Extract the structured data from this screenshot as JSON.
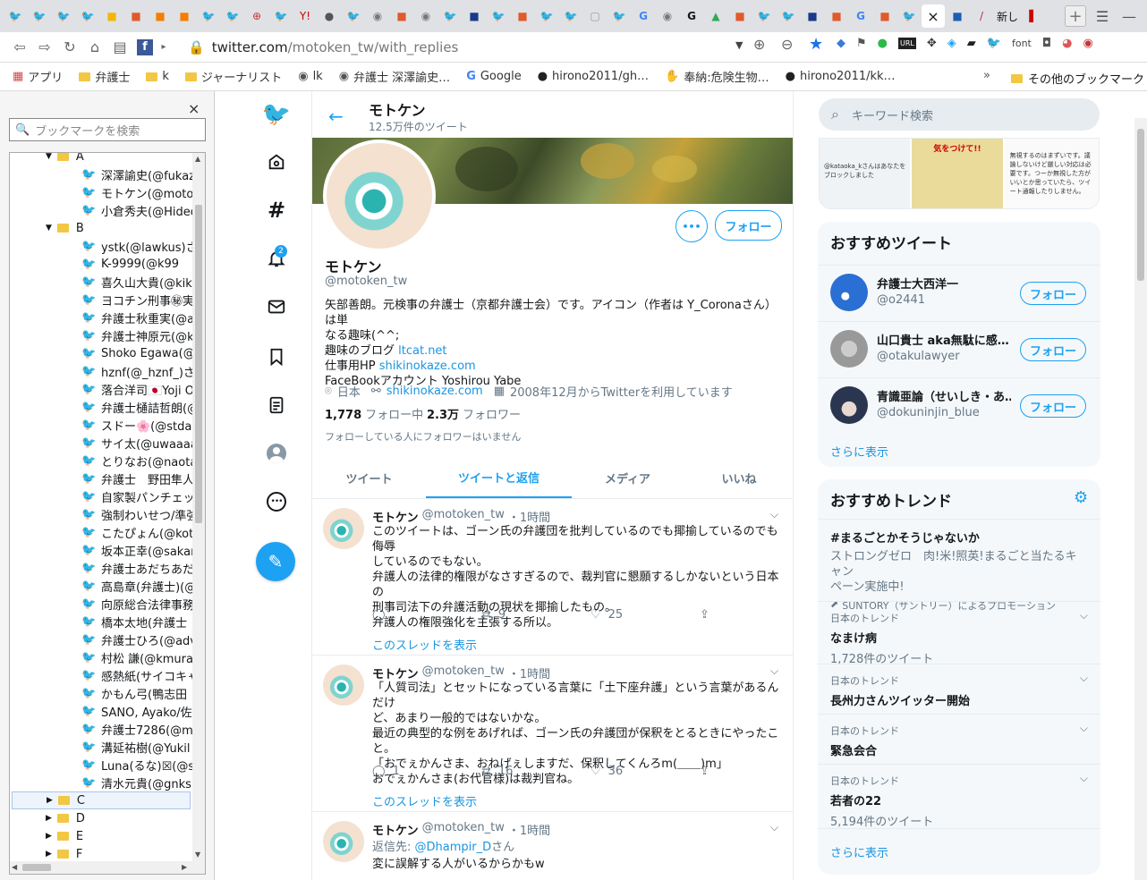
{
  "browser": {
    "url_host": "twitter.com",
    "url_path": "/motoken_tw/with_replies",
    "tab_label_1": "新し",
    "bookmarks": [
      "アプリ",
      "弁護士",
      "k",
      "ジャーナリスト",
      "lk",
      "弁護士 深澤諭史…",
      "Google",
      "hirono2011/gh…",
      "奉納:危険生物…",
      "hirono2011/kk…"
    ],
    "other_bookmarks": "その他のブックマーク",
    "overflow": "»"
  },
  "sidebar": {
    "search_placeholder": "ブックマークを検索",
    "close": "×",
    "folder_a": "A",
    "folder_b": "B",
    "items_a": [
      "深澤諭史(@fukaz",
      "モトケン(@motoke",
      "小倉秀夫(@Hideo"
    ],
    "items_b": [
      "ystk(@lawkus)さん",
      "K-9999(@k99",
      "喜久山大貴(@kik",
      "ヨコチン刑事㊙実況",
      "弁護士秋重実(@a",
      "弁護士神原元(@k",
      "Shoko Egawa(@a",
      "hznf(@_hznf_)さん",
      "落合洋司🇯🇵Yoji O",
      "弁護士樋詰哲朗(@",
      "スドー🌸(@stdau",
      "サイ太(@uwaaaa)",
      "とりなお(@naotar",
      "弁護士　野田隼人",
      "自家製パンチェッタ",
      "強制わいせつ/準強",
      "こたぴょん(@kotac",
      "坂本正幸(@sakam",
      "弁護士あだちあだち",
      "高島章(弁護士)(@",
      "向原総合法律事務",
      "橋本太地(弁護士",
      "弁護士ひろ(@adv",
      "村松 謙(@kmuran",
      "感熱紙(サイコキャ",
      "かもん弓(鴨志田",
      "SANO, Ayako/佐",
      "弁護士7286(@m",
      "溝延祐樹(@Yukil",
      "Luna(るな)☒(@s",
      "清水元貴(@gnks"
    ],
    "folders_rest": [
      "C",
      "D",
      "E",
      "F"
    ]
  },
  "header": {
    "name": "モトケン",
    "tweet_count": "12.5万件のツイート"
  },
  "profile": {
    "name": "モトケン",
    "handle": "@motoken_tw",
    "bio_line1": "矢部善朗。元検事の弁護士（京都弁護士会）です。アイコン（作者は Y_Coronaさん）は単",
    "bio_line2": "なる趣味(^^;",
    "bio_blog_label": "趣味のブログ ",
    "bio_blog_link": "ltcat.net",
    "bio_hp_label": "仕事用HP ",
    "bio_hp_link": "shikinokaze.com",
    "bio_fb": "FaceBookアカウント Yoshirou Yabe",
    "location": "日本",
    "website": "shikinokaze.com",
    "joined": "2008年12月からTwitterを利用しています",
    "following_count": "1,778",
    "following_label": "フォロー中",
    "followers_count": "2.3万",
    "followers_label": "フォロワー",
    "mutual_note": "フォローしている人にフォロワーはいません",
    "more": "•••",
    "follow": "フォロー"
  },
  "tabs": [
    "ツイート",
    "ツイートと返信",
    "メディア",
    "いいね"
  ],
  "tweets": [
    {
      "name": "モトケン",
      "handle": "@motoken_tw",
      "time": "・1時間",
      "lines": [
        "このツイートは、ゴーン氏の弁護団を批判しているのでも揶揄しているのでも侮辱",
        "しているのでもない。",
        "弁護人の法律的権限がなさすぎるので、裁判官に懇願するしかないという日本の",
        "刑事司法下の弁護活動の現状を揶揄したもの。",
        "弁護人の権限強化を主張する所以。"
      ],
      "reply_count": "",
      "retweet_count": "9",
      "like_count": "25",
      "thread": "このスレッドを表示"
    },
    {
      "name": "モトケン",
      "handle": "@motoken_tw",
      "time": "・1時間",
      "lines": [
        "「人質司法」とセットになっている言葉に「土下座弁護」という言葉があるんだけ",
        "ど、あまり一般的ではないかな。",
        "最近の典型的な例をあげれば、ゴーン氏の弁護団が保釈をとるときにやったこと。",
        "「おでぇかんさま、おねげぇしますだ、保釈してくんろm(＿＿)m」",
        "おでぇかんさま(お代官様)は裁判官ね。"
      ],
      "reply_count": "1",
      "retweet_count": "16",
      "like_count": "36",
      "thread": "このスレッドを表示"
    },
    {
      "name": "モトケン",
      "handle": "@motoken_tw",
      "time": "・1時間",
      "reply_label": "返信先: ",
      "reply_to": "@Dhampir_D",
      "reply_suffix": "さん",
      "lines": [
        "変に誤解する人がいるからかもw"
      ]
    }
  ],
  "search": {
    "placeholder": "キーワード検索"
  },
  "media_captions": [
    "@kataoka_kさんはあなたをブロックしました",
    "気をつけて!!",
    "無視するのはまずいです。議論しないけど厳しい対応は必要です。つーか無視した方がいいとか思っていたら、ツイート通報したりしません。"
  ],
  "recommended": {
    "title": "おすすめツイート",
    "users": [
      {
        "name": "弁護士大西洋一",
        "handle": "@o2441"
      },
      {
        "name": "山口貴士 aka無駄に感…",
        "handle": "@otakulawyer"
      },
      {
        "name": "青識亜論（せいしき・あ…",
        "handle": "@dokuninjin_blue"
      }
    ],
    "follow": "フォロー",
    "more": "さらに表示"
  },
  "trends": {
    "title": "おすすめトレンド",
    "promoted": {
      "name": "#まるごとかそうじゃないか",
      "desc1": "ストロングゼロ　肉!米!照英!まるごと当たるキャン",
      "desc2": "ペーン実施中!",
      "by": "SUNTORY（サントリー）によるプロモーション"
    },
    "items": [
      {
        "context": "日本のトレンド",
        "name": "なまけ病",
        "count": "1,728件のツイート"
      },
      {
        "context": "日本のトレンド",
        "name": "長州力さんツイッター開始",
        "count": ""
      },
      {
        "context": "日本のトレンド",
        "name": "緊急会合",
        "count": ""
      },
      {
        "context": "日本のトレンド",
        "name": "若者の22",
        "count": "5,194件のツイート"
      }
    ],
    "more": "さらに表示"
  },
  "notification_badge": "2",
  "colors": {
    "accent": "#1da1f2",
    "folder": "#f2c744"
  }
}
